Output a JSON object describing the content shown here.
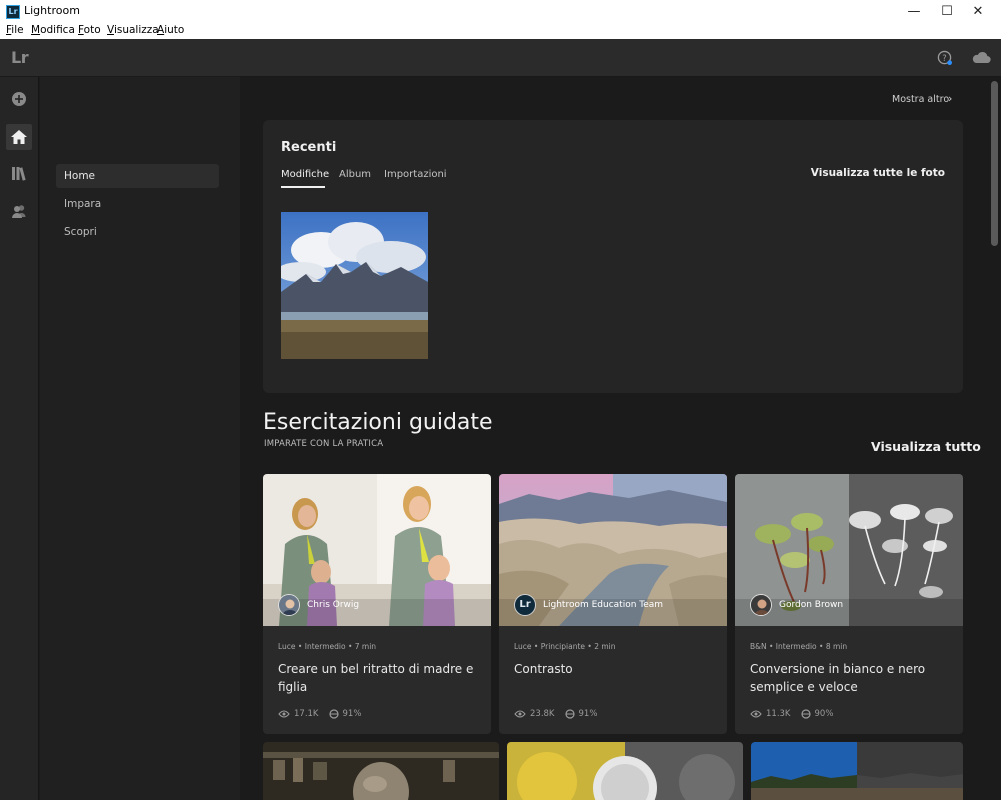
{
  "window": {
    "title": "Lightroom",
    "icon_text": "Lr",
    "minimize": "—",
    "maximize": "☐",
    "close": "✕"
  },
  "menu": [
    "File",
    "Modifica",
    "Foto",
    "Visualizza",
    "Aiuto"
  ],
  "topbar": {
    "logo": "Lr",
    "icons": [
      "help-icon",
      "cloud-icon"
    ]
  },
  "rail": {
    "icons": [
      "add-icon",
      "home-icon",
      "library-icon",
      "people-icon"
    ]
  },
  "sidenav": {
    "items": [
      {
        "label": "Home",
        "active": true
      },
      {
        "label": "Impara"
      },
      {
        "label": "Scopri"
      }
    ]
  },
  "top_link": {
    "label": "Mostra altro",
    "chevron": "›"
  },
  "recent": {
    "title": "Recenti",
    "tabs": [
      {
        "label": "Modifiche",
        "active": true
      },
      {
        "label": "Album"
      },
      {
        "label": "Importazioni"
      }
    ],
    "view_all": "Visualizza tutte le foto"
  },
  "tutorials": {
    "title": "Esercitazioni guidate",
    "subtitle": "IMPARATE CON LA PRATICA",
    "view_all": "Visualizza tutto",
    "cards": [
      {
        "author": "Chris Orwig",
        "meta": "Luce • Intermedio • 7 min",
        "title": "Creare un bel ritratto di madre e figlia",
        "views": "17.1K",
        "rating": "91%"
      },
      {
        "author": "Lightroom Education Team",
        "avatar_text": "Lr",
        "meta": "Luce • Principiante • 2 min",
        "title": "Contrasto",
        "views": "23.8K",
        "rating": "91%"
      },
      {
        "author": "Gordon Brown",
        "meta": "B&N • Intermedio • 8 min",
        "title": "Conversione in bianco e nero semplice e veloce",
        "views": "11.3K",
        "rating": "90%"
      }
    ]
  },
  "colors": {
    "background": "#1b1b1b",
    "panel": "#252525",
    "card": "#2a2a2a",
    "text": "#f0f0f0",
    "accent_help": "#2b8fff"
  }
}
